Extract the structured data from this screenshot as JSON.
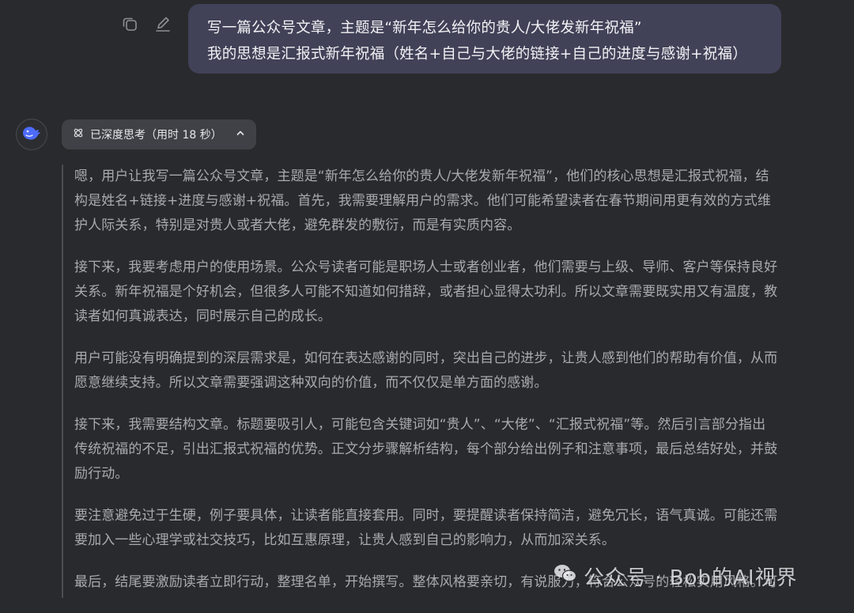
{
  "user_message": {
    "line1": "写一篇公众号文章，主题是“新年怎么给你的贵人/大佬发新年祝福”",
    "line2": "我的思想是汇报式新年祝福（姓名+自己与大佬的链接+自己的进度与感谢+祝福）",
    "actions": [
      {
        "icon": "copy-icon"
      },
      {
        "icon": "edit-icon"
      }
    ]
  },
  "assistant": {
    "avatar_icon": "deepseek-whale-logo",
    "thinking_toggle": {
      "icon": "atom-icon",
      "label": "已深度思考（用时 18 秒）",
      "chevron": "chevron-up-icon"
    },
    "thought_paragraphs": [
      "嗯，用户让我写一篇公众号文章，主题是“新年怎么给你的贵人/大佬发新年祝福”，他们的核心思想是汇报式祝福，结构是姓名+链接+进度与感谢+祝福。首先，我需要理解用户的需求。他们可能希望读者在春节期间用更有效的方式维护人际关系，特别是对贵人或者大佬，避免群发的敷衍，而是有实质内容。",
      "接下来，我要考虑用户的使用场景。公众号读者可能是职场人士或者创业者，他们需要与上级、导师、客户等保持良好关系。新年祝福是个好机会，但很多人可能不知道如何措辞，或者担心显得太功利。所以文章需要既实用又有温度，教读者如何真诚表达，同时展示自己的成长。",
      "用户可能没有明确提到的深层需求是，如何在表达感谢的同时，突出自己的进步，让贵人感到他们的帮助有价值，从而愿意继续支持。所以文章需要强调这种双向的价值，而不仅仅是单方面的感谢。",
      "接下来，我需要结构文章。标题要吸引人，可能包含关键词如“贵人”、“大佬”、“汇报式祝福”等。然后引言部分指出传统祝福的不足，引出汇报式祝福的优势。正文分步骤解析结构，每个部分给出例子和注意事项，最后总结好处，并鼓励行动。",
      "要注意避免过于生硬，例子要具体，让读者能直接套用。同时，要提醒读者保持简洁，避免冗长，语气真诚。可能还需要加入一些心理学或社交技巧，比如互惠原理，让贵人感到自己的影响力，从而加深关系。",
      "最后，结尾要激励读者立即行动，整理名单，开始撰写。整体风格要亲切，有说服力，符合公众号的轻松实用风格。可能需要检查是否有遗漏的部分，比如是否要区分不同的贵人类型，但可能保持通用性更好，让读者自行调整。"
    ]
  },
  "watermark": {
    "icon": "wechat-icon",
    "text": "公众号 · Bob的AI视界"
  },
  "colors": {
    "background": "#292a2d",
    "user_bubble": "#414158",
    "toggle_bg": "#404146",
    "thought_text": "#a9aab0",
    "accent": "#4d6bfe"
  }
}
